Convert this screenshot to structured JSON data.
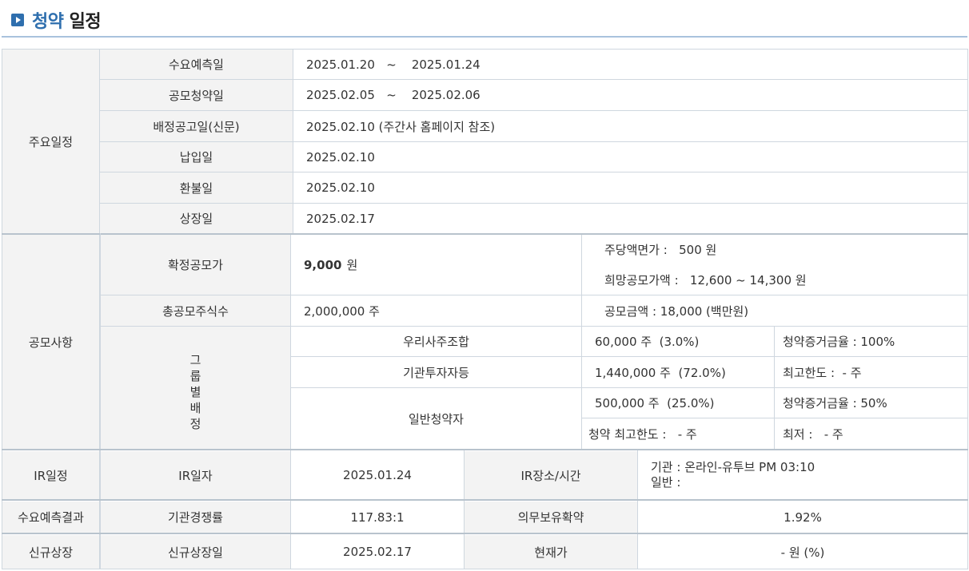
{
  "header": {
    "title_highlight": "청약",
    "title_rest": "일정"
  },
  "schedule": {
    "section": "주요일정",
    "rows": [
      {
        "label": "수요예측일",
        "value": "2025.01.20   ~    2025.01.24"
      },
      {
        "label": "공모청약일",
        "value": "2025.02.05   ~    2025.02.06"
      },
      {
        "label": "배정공고일(신문)",
        "value": "2025.02.10 (주간사 홈페이지 참조)"
      },
      {
        "label": "납입일",
        "value": "2025.02.10"
      },
      {
        "label": "환불일",
        "value": "2025.02.10"
      },
      {
        "label": "상장일",
        "value": "2025.02.17"
      }
    ]
  },
  "offering": {
    "section": "공모사항",
    "price_label": "확정공모가",
    "price_value": "9,000",
    "price_unit": "원",
    "par_value": "주당액면가 :   500 원",
    "desired_price": "희망공모가액 :   12,600 ~ 14,300 원",
    "total_shares_label": "총공모주식수",
    "total_shares_value": "2,000,000 주",
    "offer_amount": "공모금액 : 18,000 (백만원)",
    "group_label": "그룹별배정",
    "group_chars": [
      "그",
      "룹",
      "별",
      "배",
      "정"
    ],
    "groups": [
      {
        "name": "우리사주조합",
        "shares": "60,000 주  (3.0%)",
        "note": "청약증거금율 : 100%"
      },
      {
        "name": "기관투자자등",
        "shares": "1,440,000 주  (72.0%)",
        "note": "최고한도 :  - 주"
      },
      {
        "name": "일반청약자",
        "shares": "500,000 주  (25.0%)",
        "note": "청약증거금율 : 50%",
        "limit_max": "청약 최고한도 :   - 주",
        "limit_min": "최저 :   - 주"
      }
    ]
  },
  "ir": {
    "section": "IR일정",
    "date_label": "IR일자",
    "date_value": "2025.01.24",
    "place_label": "IR장소/시간",
    "place_inst": "기관 : 온라인-유투브 PM 03:10",
    "place_general": "일반 :"
  },
  "demand": {
    "section": "수요예측결과",
    "competition_label": "기관경쟁률",
    "competition_value": "117.83:1",
    "lockup_label": "의무보유확약",
    "lockup_value": "1.92%"
  },
  "listing": {
    "section": "신규상장",
    "date_label": "신규상장일",
    "date_value": "2025.02.17",
    "price_label": "현재가",
    "price_value": "- 원 (%)"
  }
}
